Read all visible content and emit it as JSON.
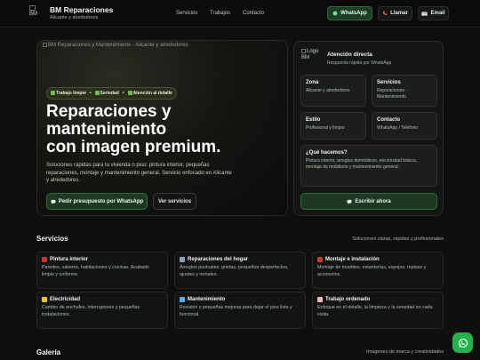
{
  "header": {
    "logo_text": "BM",
    "brand_title": "BM Reparaciones",
    "brand_subtitle": "Alicante y alrededores",
    "nav": [
      "Servicios",
      "Trabajos",
      "Contacto"
    ],
    "whatsapp_label": "WhatsApp",
    "call_label": "Llamar",
    "email_label": "Email"
  },
  "hero": {
    "image_caption": "BM Reparaciones y Mantenimiento - Alicante y alrededores",
    "badges": [
      "Trabajo limpio",
      "Seriedad",
      "Atención al detalle"
    ],
    "heading_lines": [
      "Reparaciones y",
      "mantenimiento",
      "con imagen premium."
    ],
    "description": "Soluciones rápidas para tu vivienda o piso: pintura interior, pequeñas reparaciones, montaje y mantenimiento general. Servicio enfocado en Alicante y alrededores.",
    "primary_cta": "Pedir presupuesto por WhatsApp",
    "secondary_cta": "Ver servicios"
  },
  "panel": {
    "logo_text": "Logo BM",
    "title": "Atención directa",
    "subtitle": "Respuesta rápida por WhatsApp",
    "tiles": [
      {
        "label": "Zona",
        "value": "Alicante y alrededores"
      },
      {
        "label": "Servicios",
        "value": "Reparaciones · Mantenimiento"
      },
      {
        "label": "Estilo",
        "value": "Profesional y limpio"
      },
      {
        "label": "Contacto",
        "value": "WhatsApp / Teléfono"
      }
    ],
    "how_title": "¿Qué hacemos?",
    "how_text": "Pintura interior, arreglos domésticos, electricidad básica, montaje de mobiliario y mantenimiento general.",
    "write_label": "Escribir ahora"
  },
  "services": {
    "title": "Servicios",
    "subtitle": "Soluciones claras, rápidas y profesionales",
    "items": [
      {
        "title": "Pintura interior",
        "desc": "Paredes, salones, habitaciones y cocinas. Acabado limpio y uniforme.",
        "icon": "paint-icon",
        "color": "#c0392b"
      },
      {
        "title": "Reparaciones del hogar",
        "desc": "Arreglos puntuales: grietas, pequeños desperfectos, ajustes y remates.",
        "icon": "wrench-icon",
        "color": "#8aa0b8"
      },
      {
        "title": "Montaje e instalación",
        "desc": "Montaje de muebles, estanterías, espejos, repisas y accesorios.",
        "icon": "toolbox-icon",
        "color": "#c0392b"
      },
      {
        "title": "Electricidad",
        "desc": "Cambio de enchufes, interruptores y pequeñas instalaciones.",
        "icon": "bolt-icon",
        "color": "#f1c40f"
      },
      {
        "title": "Mantenimiento",
        "desc": "Revisión y pequeñas mejoras para dejar el piso listo y funcional.",
        "icon": "screwdriver-icon",
        "color": "#5dade2"
      },
      {
        "title": "Trabajo ordenado",
        "desc": "Enfoque en el detalle, la limpieza y la seriedad en cada visita.",
        "icon": "soap-icon",
        "color": "#f5b7c0"
      }
    ]
  },
  "gallery": {
    "title": "Galería",
    "subtitle": "Imágenes de marca y creatividades"
  },
  "colors": {
    "accent_green": "#23b24c",
    "background": "#0e0f0e"
  }
}
